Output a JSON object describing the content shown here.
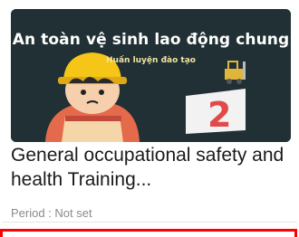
{
  "card": {
    "thumbnail": {
      "title": "An toàn vệ sinh lao động chung",
      "subtitle": "Huấn luyện đào tạo",
      "badge_number": "2",
      "icons": [
        "worker-illustration-icon",
        "forklift-icon",
        "number-two-sign-icon"
      ]
    },
    "title": "General occupational safety and health Training...",
    "period_label": "Period : Not set"
  },
  "colors": {
    "thumbnail_bg": "#1e2a2e",
    "helmet": "#f5c518",
    "highlight_border": "#ff0000",
    "title_text": "#1a1a1a",
    "muted_text": "#8a8a8a"
  }
}
